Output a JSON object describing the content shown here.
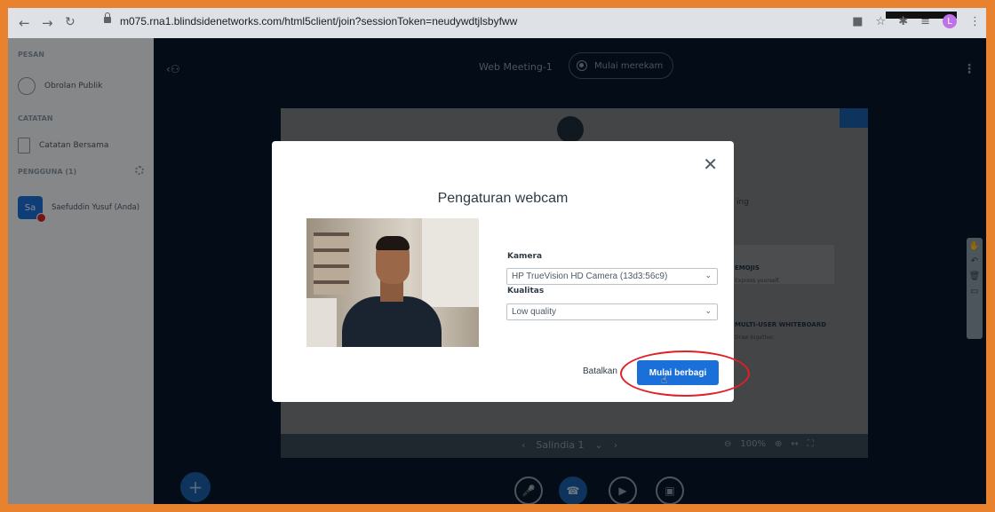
{
  "browser": {
    "url": "m075.rna1.blindsidenetworks.com/html5client/join?sessionToken=neudywdtjlsbyfww",
    "profile_initial": "L",
    "accent_orange": "#e8822e"
  },
  "sidebar": {
    "messages_heading": "PESAN",
    "public_chat": "Obrolan Publik",
    "notes_heading": "CATATAN",
    "shared_notes": "Catatan Bersama",
    "users_heading": "PENGGUNA (1)",
    "user": {
      "initials": "Sa",
      "name": "Saefuddin Yusuf (Anda)"
    }
  },
  "header": {
    "meeting_title": "Web Meeting-1",
    "record_label": "Mulai merekam"
  },
  "presentation": {
    "slide_label": "Salindia 1",
    "zoom_value": "100%",
    "card1_title": "EMOJIS",
    "card1_sub": "Express yourself.",
    "card2_title": "MULTI-USER WHITEBOARD",
    "card2_sub": "Draw together.",
    "partial_text": "ing"
  },
  "modal": {
    "title": "Pengaturan webcam",
    "camera_label": "Kamera",
    "camera_value": "HP TrueVision HD Camera (13d3:56c9)",
    "quality_label": "Kualitas",
    "quality_value": "Low quality",
    "cancel_label": "Batalkan",
    "share_label": "Mulai berbagi",
    "highlight_color": "#e01f26"
  }
}
